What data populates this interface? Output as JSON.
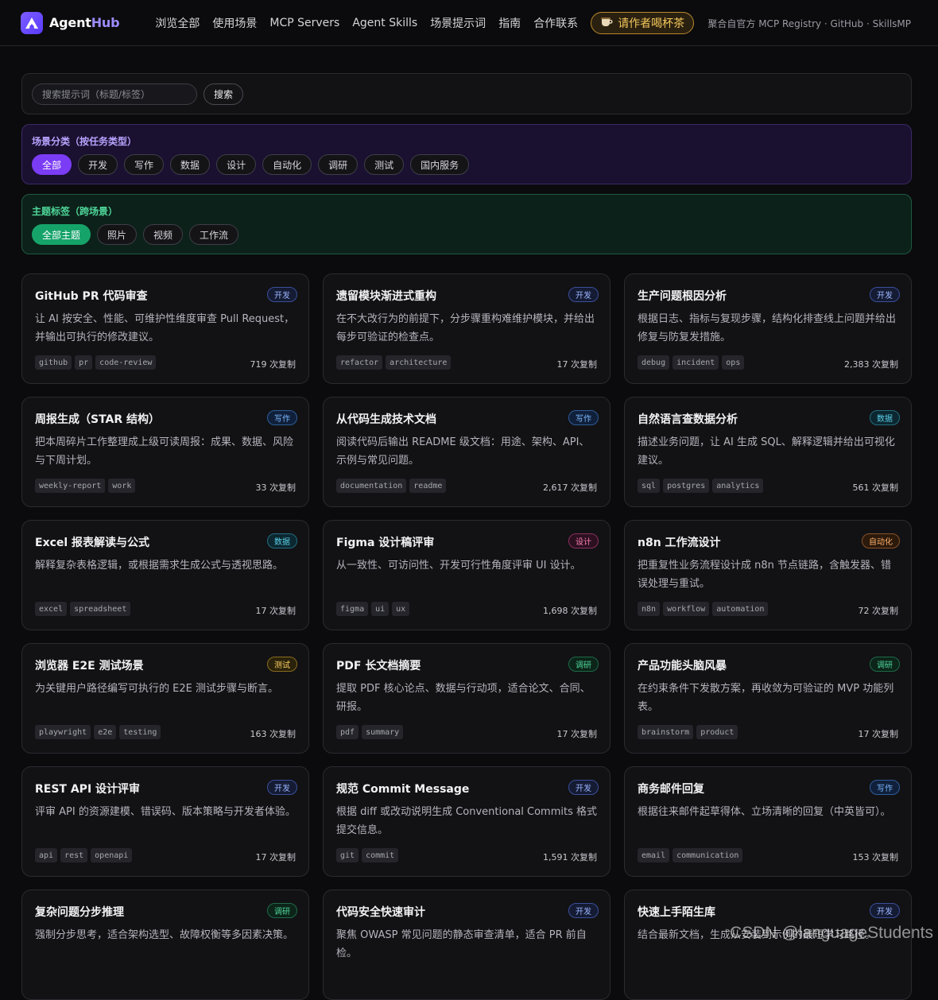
{
  "brand": {
    "name_a": "Agent",
    "name_b": "Hub"
  },
  "nav": [
    "浏览全部",
    "使用场景",
    "MCP Servers",
    "Agent Skills",
    "场景提示词",
    "指南",
    "合作联系"
  ],
  "tea_button": {
    "icon": "tea-cup-icon",
    "label": "请作者喝杯茶"
  },
  "sources": "聚合自官方 MCP Registry · GitHub · SkillsMP",
  "search": {
    "placeholder": "搜索提示词（标题/标签）",
    "button": "搜索"
  },
  "scene_filter": {
    "title": "场景分类（按任务类型）",
    "chips": [
      "全部",
      "开发",
      "写作",
      "数据",
      "设计",
      "自动化",
      "调研",
      "测试",
      "国内服务"
    ],
    "active": "全部"
  },
  "topic_filter": {
    "title": "主题标签（跨场景）",
    "chips": [
      "全部主题",
      "照片",
      "视频",
      "工作流"
    ],
    "active": "全部主题"
  },
  "cards": [
    {
      "title": "GitHub PR 代码审查",
      "badge": "开发",
      "kind": "dev",
      "desc": "让 AI 按安全、性能、可维护性维度审查 Pull Request，并输出可执行的修改建议。",
      "tags": [
        "github",
        "pr",
        "code-review"
      ],
      "copies": "719 次复制"
    },
    {
      "title": "遗留模块渐进式重构",
      "badge": "开发",
      "kind": "dev",
      "desc": "在不大改行为的前提下，分步骤重构难维护模块，并给出每步可验证的检查点。",
      "tags": [
        "refactor",
        "architecture"
      ],
      "copies": "17 次复制"
    },
    {
      "title": "生产问题根因分析",
      "badge": "开发",
      "kind": "dev",
      "desc": "根据日志、指标与复现步骤，结构化排查线上问题并给出修复与防复发措施。",
      "tags": [
        "debug",
        "incident",
        "ops"
      ],
      "copies": "2,383 次复制"
    },
    {
      "title": "周报生成（STAR 结构）",
      "badge": "写作",
      "kind": "write",
      "desc": "把本周碎片工作整理成上级可读周报：成果、数据、风险与下周计划。",
      "tags": [
        "weekly-report",
        "work"
      ],
      "copies": "33 次复制"
    },
    {
      "title": "从代码生成技术文档",
      "badge": "写作",
      "kind": "write",
      "desc": "阅读代码后输出 README 级文档：用途、架构、API、示例与常见问题。",
      "tags": [
        "documentation",
        "readme"
      ],
      "copies": "2,617 次复制"
    },
    {
      "title": "自然语言查数据分析",
      "badge": "数据",
      "kind": "data",
      "desc": "描述业务问题，让 AI 生成 SQL、解释逻辑并给出可视化建议。",
      "tags": [
        "sql",
        "postgres",
        "analytics"
      ],
      "copies": "561 次复制"
    },
    {
      "title": "Excel 报表解读与公式",
      "badge": "数据",
      "kind": "data",
      "desc": "解释复杂表格逻辑，或根据需求生成公式与透视思路。",
      "tags": [
        "excel",
        "spreadsheet"
      ],
      "copies": "17 次复制"
    },
    {
      "title": "Figma 设计稿评审",
      "badge": "设计",
      "kind": "design",
      "desc": "从一致性、可访问性、开发可行性角度评审 UI 设计。",
      "tags": [
        "figma",
        "ui",
        "ux"
      ],
      "copies": "1,698 次复制"
    },
    {
      "title": "n8n 工作流设计",
      "badge": "自动化",
      "kind": "auto",
      "desc": "把重复性业务流程设计成 n8n 节点链路，含触发器、错误处理与重试。",
      "tags": [
        "n8n",
        "workflow",
        "automation"
      ],
      "copies": "72 次复制"
    },
    {
      "title": "浏览器 E2E 测试场景",
      "badge": "测试",
      "kind": "test",
      "desc": "为关键用户路径编写可执行的 E2E 测试步骤与断言。",
      "tags": [
        "playwright",
        "e2e",
        "testing"
      ],
      "copies": "163 次复制"
    },
    {
      "title": "PDF 长文档摘要",
      "badge": "调研",
      "kind": "research",
      "desc": "提取 PDF 核心论点、数据与行动项，适合论文、合同、研报。",
      "tags": [
        "pdf",
        "summary"
      ],
      "copies": "17 次复制"
    },
    {
      "title": "产品功能头脑风暴",
      "badge": "调研",
      "kind": "research",
      "desc": "在约束条件下发散方案，再收敛为可验证的 MVP 功能列表。",
      "tags": [
        "brainstorm",
        "product"
      ],
      "copies": "17 次复制"
    },
    {
      "title": "REST API 设计评审",
      "badge": "开发",
      "kind": "dev",
      "desc": "评审 API 的资源建模、错误码、版本策略与开发者体验。",
      "tags": [
        "api",
        "rest",
        "openapi"
      ],
      "copies": "17 次复制"
    },
    {
      "title": "规范 Commit Message",
      "badge": "开发",
      "kind": "dev",
      "desc": "根据 diff 或改动说明生成 Conventional Commits 格式提交信息。",
      "tags": [
        "git",
        "commit"
      ],
      "copies": "1,591 次复制"
    },
    {
      "title": "商务邮件回复",
      "badge": "写作",
      "kind": "write",
      "desc": "根据往来邮件起草得体、立场清晰的回复（中英皆可）。",
      "tags": [
        "email",
        "communication"
      ],
      "copies": "153 次复制"
    },
    {
      "title": "复杂问题分步推理",
      "badge": "调研",
      "kind": "research",
      "desc": "强制分步思考，适合架构选型、故障权衡等多因素决策。",
      "tags": [],
      "copies": ""
    },
    {
      "title": "代码安全快速审计",
      "badge": "开发",
      "kind": "dev",
      "desc": "聚焦 OWASP 常见问题的静态审查清单，适合 PR 前自检。",
      "tags": [],
      "copies": ""
    },
    {
      "title": "快速上手陌生库",
      "badge": "开发",
      "kind": "dev",
      "desc": "结合最新文档，生成从安装到示例的最短学习路径。",
      "tags": [],
      "copies": ""
    }
  ],
  "watermark": "CSDN @languageStudents"
}
